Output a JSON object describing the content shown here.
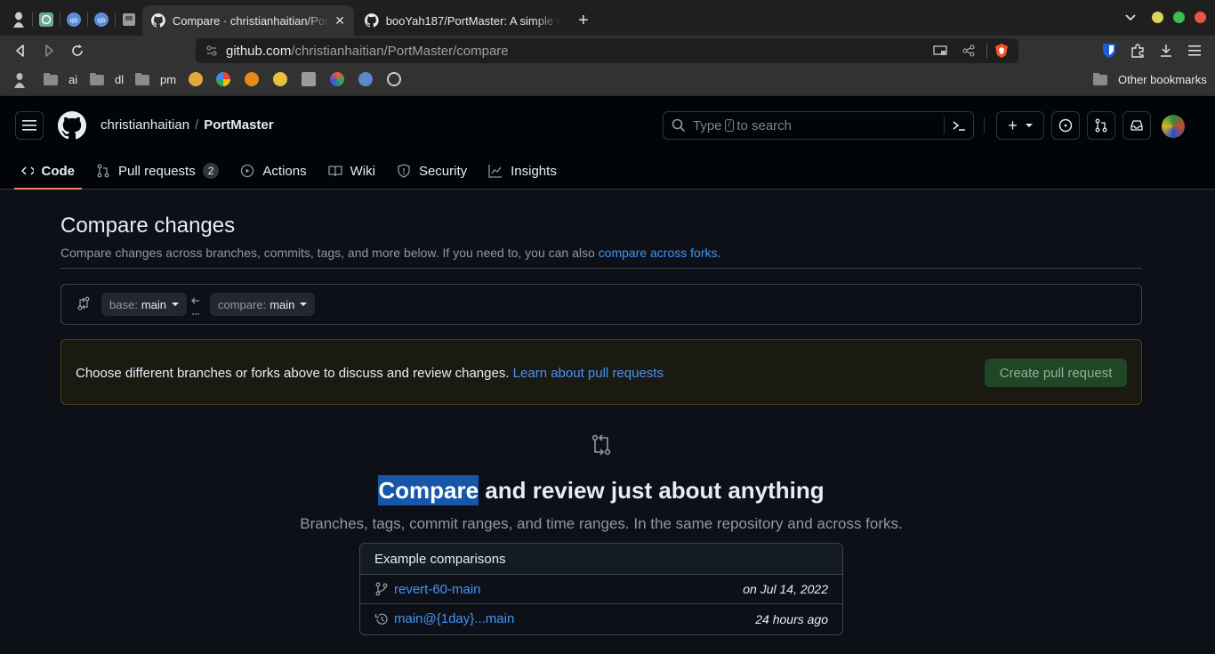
{
  "browser": {
    "tabs": [
      {
        "title": "Compare · christianhaitian/PortMaster",
        "active": true
      },
      {
        "title": "booYah187/PortMaster: A simple tool",
        "active": false
      }
    ],
    "url_domain": "github.com",
    "url_path": "/christianhaitian/PortMaster/compare",
    "bookmarks": [
      "ai",
      "dl",
      "pm"
    ],
    "other_bookmarks": "Other bookmarks"
  },
  "header": {
    "owner": "christianhaitian",
    "separator": "/",
    "repo": "PortMaster",
    "search_prefix": "Type",
    "search_key": "/",
    "search_suffix": "to search",
    "plus_label": "+"
  },
  "repo_nav": {
    "code": "Code",
    "pulls": "Pull requests",
    "pulls_count": "2",
    "actions": "Actions",
    "wiki": "Wiki",
    "security": "Security",
    "insights": "Insights"
  },
  "compare": {
    "title": "Compare changes",
    "subtitle": "Compare changes across branches, commits, tags, and more below. If you need to, you can also",
    "subtitle_link": "compare across forks",
    "subtitle_end": ".",
    "base_label": "base:",
    "base_value": "main",
    "compare_label": "compare:",
    "compare_value": "main",
    "flash_text": "Choose different branches or forks above to discuss and review changes.",
    "flash_link": "Learn about pull requests",
    "create_pr": "Create pull request",
    "blank_title_highlight": "Compare",
    "blank_title_rest": "and review just about anything",
    "blank_subtitle": "Branches, tags, commit ranges, and time ranges. In the same repository and across forks.",
    "examples_heading": "Example comparisons",
    "examples": [
      {
        "ref": "revert-60-main",
        "when": "on Jul 14, 2022"
      },
      {
        "ref": "main@{1day}...main",
        "when": "24 hours ago"
      }
    ]
  }
}
